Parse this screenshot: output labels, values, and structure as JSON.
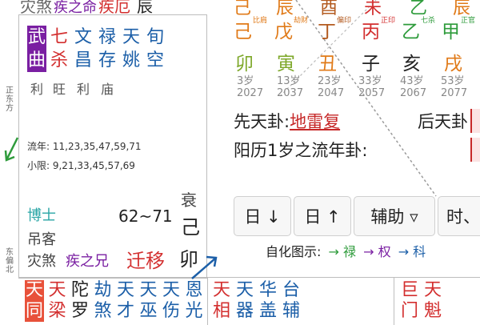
{
  "top_left_strip": [
    "灾煞",
    "疾之命",
    "疾厄",
    "辰"
  ],
  "left_palace": {
    "stars": [
      {
        "top": "武",
        "bottom": "曲",
        "color": "purple",
        "highlight": true,
        "brightness": "利"
      },
      {
        "top": "七",
        "bottom": "杀",
        "color": "red",
        "brightness": "旺"
      },
      {
        "top": "文",
        "bottom": "昌",
        "color": "blue",
        "brightness": "利"
      },
      {
        "top": "禄",
        "bottom": "存",
        "color": "blue",
        "brightness": "庙"
      },
      {
        "top": "天",
        "bottom": "姚",
        "color": "blue",
        "brightness": ""
      },
      {
        "top": "旬",
        "bottom": "空",
        "color": "blue",
        "brightness": ""
      }
    ],
    "side_top": "正东方",
    "side_bottom": "东偏北",
    "liu_nian": "流年: 11,23,35,47,59,71",
    "xiao_xian": "小限: 9,21,33,45,57,69",
    "bo_shi": "博士",
    "diao_ke": "吊客",
    "zai_sha": "灾煞",
    "palace_sub": "疾之兄",
    "palace_name": "迁移",
    "age_range": "62~71",
    "stage": "衰",
    "stem": "己",
    "branch": "卯"
  },
  "stems_top": [
    "己",
    "辰",
    "酉",
    "未",
    "",
    "乙",
    "辰"
  ],
  "stems": [
    {
      "gan": "己",
      "tag": "比肩",
      "color": "orange"
    },
    {
      "gan": "戊",
      "tag": "劫财",
      "color": "orange"
    },
    {
      "gan": "丁",
      "tag": "偏印",
      "color": "brown"
    },
    {
      "gan": "丙",
      "tag": "正印",
      "color": "red"
    },
    {
      "gan": "乙",
      "tag": "七杀",
      "color": "green"
    },
    {
      "gan": "甲",
      "tag": "正官",
      "color": "green"
    }
  ],
  "branches": [
    {
      "zhi": "卯",
      "color": "olive"
    },
    {
      "zhi": "寅",
      "color": "olive"
    },
    {
      "zhi": "丑",
      "color": "orange"
    },
    {
      "zhi": "子",
      "color": "black"
    },
    {
      "zhi": "亥",
      "color": "black"
    },
    {
      "zhi": "戌",
      "color": "orange"
    }
  ],
  "ages": [
    {
      "age": "3岁",
      "year": "2027"
    },
    {
      "age": "13岁",
      "year": "2037"
    },
    {
      "age": "23岁",
      "year": "2047"
    },
    {
      "age": "33岁",
      "year": "2057"
    },
    {
      "age": "43岁",
      "year": "2067"
    },
    {
      "age": "53岁",
      "year": "2077"
    }
  ],
  "xian_tian_label": "先天卦:",
  "xian_tian_value": "地雷复",
  "hou_tian_label": "后天卦",
  "yang_li_label": "阳历1岁之流年卦:",
  "buttons": [
    {
      "label": "日 ↓"
    },
    {
      "label": "日 ↑"
    },
    {
      "label": "辅助 ▿"
    },
    {
      "label": "时、"
    }
  ],
  "legend": {
    "label": "自化图示:",
    "items": [
      {
        "text": "→ 禄",
        "color": "#2e9b3b"
      },
      {
        "text": "→ 权",
        "color": "#7a1fa2"
      },
      {
        "text": "→ 科",
        "color": "#1c5fa8"
      }
    ]
  },
  "bottom_left_stars": [
    {
      "top": "天",
      "bottom": "同",
      "color": "red",
      "highlight": true
    },
    {
      "top": "天",
      "bottom": "梁",
      "color": "red"
    },
    {
      "top": "陀",
      "bottom": "罗",
      "color": "black"
    },
    {
      "top": "劫",
      "bottom": "煞",
      "color": "blue"
    },
    {
      "top": "天",
      "bottom": "才",
      "color": "blue"
    },
    {
      "top": "天",
      "bottom": "巫",
      "color": "blue"
    },
    {
      "top": "天",
      "bottom": "伤",
      "color": "blue"
    },
    {
      "top": "恩",
      "bottom": "光",
      "color": "blue"
    }
  ],
  "bottom_mid_stars": [
    {
      "top": "天",
      "bottom": "相",
      "color": "red"
    },
    {
      "top": "天",
      "bottom": "器",
      "color": "blue"
    },
    {
      "top": "华",
      "bottom": "盖",
      "color": "blue"
    },
    {
      "top": "台",
      "bottom": "辅",
      "color": "blue"
    }
  ],
  "bottom_right_stars": [
    {
      "top": "巨",
      "bottom": "门",
      "color": "red"
    },
    {
      "top": "天",
      "bottom": "魁",
      "color": "red"
    }
  ]
}
